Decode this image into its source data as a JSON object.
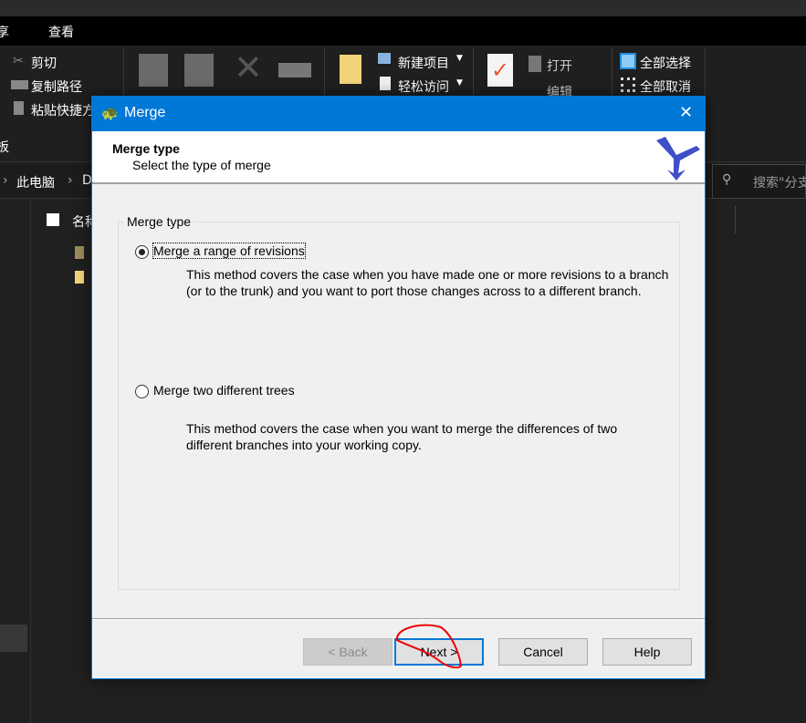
{
  "explorer": {
    "menu": [
      "享",
      "查看"
    ],
    "ribbon": {
      "cut": "剪切",
      "copy_path": "复制路径",
      "paste_shortcut": "粘贴快捷方",
      "clipboard_group": "板",
      "new_item": "新建项目",
      "easy_access": "轻松访问",
      "open": "打开",
      "edit": "编辑",
      "select_all": "全部选择",
      "select_none": "全部取消"
    },
    "breadcrumb": [
      "此电脑",
      "D"
    ],
    "search_placeholder": "搜索\"分支",
    "column_name": "名称"
  },
  "dialog": {
    "title": "Merge",
    "header_title": "Merge type",
    "header_subtitle": "Select the type of merge",
    "group_label": "Merge type",
    "options": [
      {
        "label": "Merge a range of revisions",
        "selected": true,
        "description": "This method covers the case when you have made one or more revisions to a branch (or to the trunk) and you want to port those changes across to a different branch."
      },
      {
        "label": "Merge two different trees",
        "selected": false,
        "description": "This method covers the case when you want to merge the differences of two different branches into your working copy."
      }
    ],
    "buttons": {
      "back": "< Back",
      "next": "Next >",
      "cancel": "Cancel",
      "help": "Help"
    },
    "accent": "#0078d7"
  }
}
